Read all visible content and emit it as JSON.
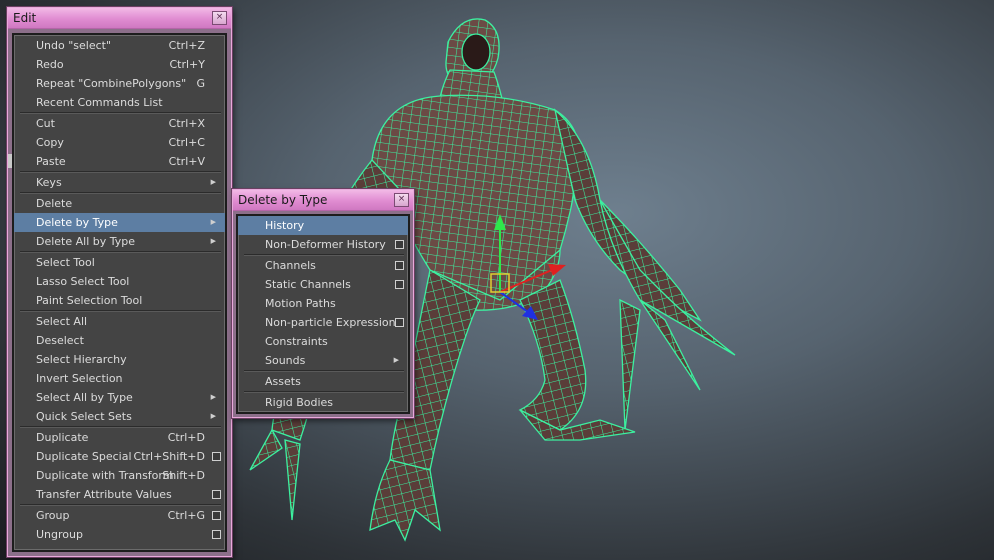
{
  "edit_menu": {
    "title": "Edit",
    "close_glyph": "×",
    "items": [
      {
        "label": "Undo \"select\"",
        "shortcut": "Ctrl+Z"
      },
      {
        "label": "Redo",
        "shortcut": "Ctrl+Y"
      },
      {
        "label": "Repeat \"CombinePolygons\"",
        "shortcut": "G"
      },
      {
        "label": "Recent Commands List",
        "shortcut": ""
      },
      {
        "label": "Cut",
        "shortcut": "Ctrl+X"
      },
      {
        "label": "Copy",
        "shortcut": "Ctrl+C"
      },
      {
        "label": "Paste",
        "shortcut": "Ctrl+V"
      },
      {
        "label": "Keys",
        "shortcut": ""
      },
      {
        "label": "Delete",
        "shortcut": ""
      },
      {
        "label": "Delete by Type",
        "shortcut": ""
      },
      {
        "label": "Delete All by Type",
        "shortcut": ""
      },
      {
        "label": "Select Tool",
        "shortcut": ""
      },
      {
        "label": "Lasso Select Tool",
        "shortcut": ""
      },
      {
        "label": "Paint Selection Tool",
        "shortcut": ""
      },
      {
        "label": "Select All",
        "shortcut": ""
      },
      {
        "label": "Deselect",
        "shortcut": ""
      },
      {
        "label": "Select Hierarchy",
        "shortcut": ""
      },
      {
        "label": "Invert Selection",
        "shortcut": ""
      },
      {
        "label": "Select All by Type",
        "shortcut": ""
      },
      {
        "label": "Quick Select Sets",
        "shortcut": ""
      },
      {
        "label": "Duplicate",
        "shortcut": "Ctrl+D"
      },
      {
        "label": "Duplicate Special",
        "shortcut": "Ctrl+Shift+D"
      },
      {
        "label": "Duplicate with Transform",
        "shortcut": "Shift+D"
      },
      {
        "label": "Transfer Attribute Values",
        "shortcut": ""
      },
      {
        "label": "Group",
        "shortcut": "Ctrl+G"
      },
      {
        "label": "Ungroup",
        "shortcut": ""
      }
    ],
    "highlighted": "Delete by Type"
  },
  "delete_by_type_menu": {
    "title": "Delete by Type",
    "close_glyph": "×",
    "items": [
      {
        "label": "History"
      },
      {
        "label": "Non-Deformer History"
      },
      {
        "label": "Channels"
      },
      {
        "label": "Static Channels"
      },
      {
        "label": "Motion Paths"
      },
      {
        "label": "Non-particle Expressions"
      },
      {
        "label": "Constraints"
      },
      {
        "label": "Sounds"
      },
      {
        "label": "Assets"
      },
      {
        "label": "Rigid Bodies"
      }
    ],
    "highlighted": "History"
  },
  "icons": {
    "submenu": "submenu-arrow-icon",
    "option_box": "option-box-icon",
    "close": "close-icon"
  },
  "colors": {
    "titlebar": "#e08cd1",
    "highlight": "#5d7ea3",
    "menu_bg": "#444444",
    "wireframe": "#3cf0a0",
    "viewport": "#56636f",
    "manip_y": "#2ee84a",
    "manip_x": "#e02020",
    "manip_z": "#2030e0"
  }
}
